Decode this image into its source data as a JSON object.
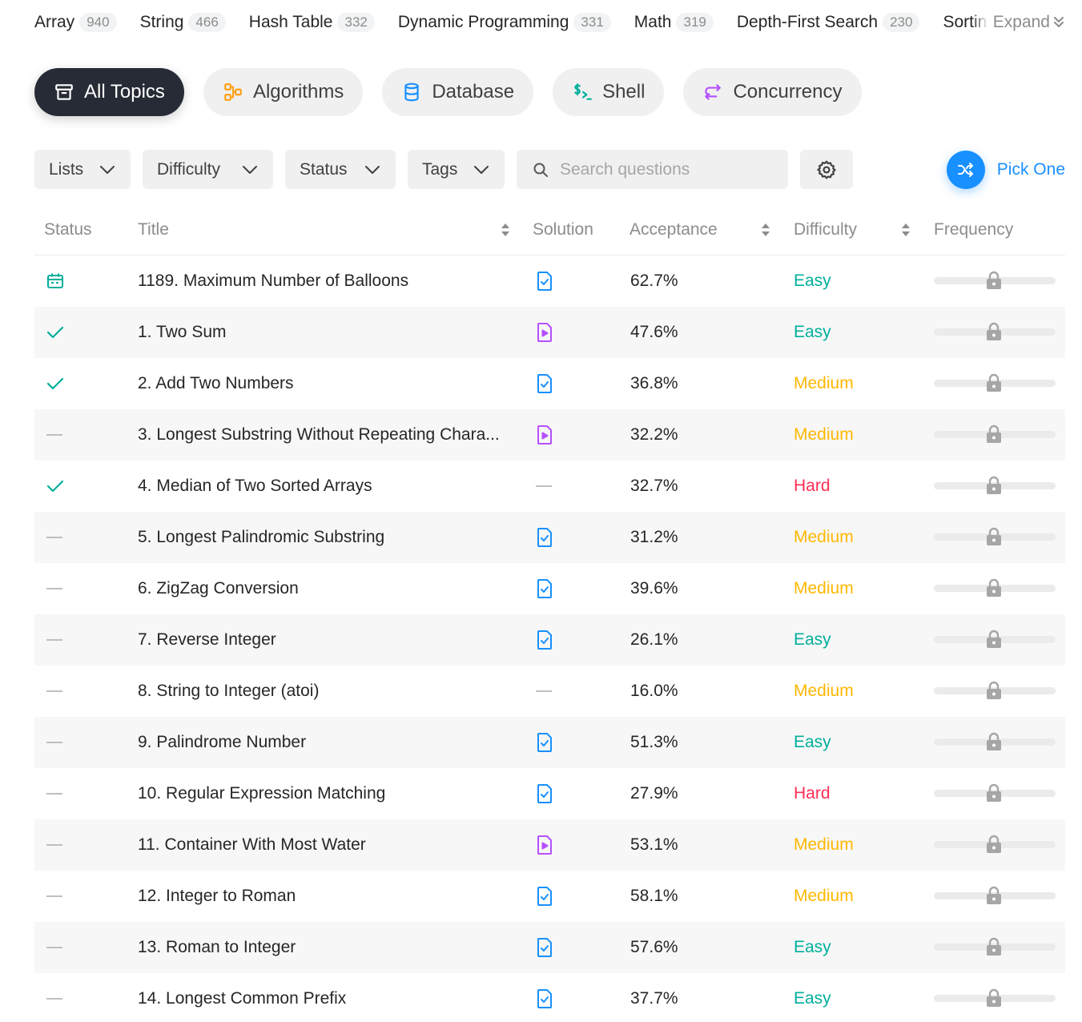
{
  "tags": [
    {
      "name": "Array",
      "count": "940"
    },
    {
      "name": "String",
      "count": "466"
    },
    {
      "name": "Hash Table",
      "count": "332"
    },
    {
      "name": "Dynamic Programming",
      "count": "331"
    },
    {
      "name": "Math",
      "count": "319"
    },
    {
      "name": "Depth-First Search",
      "count": "230"
    },
    {
      "name": "Sorting",
      "count": ""
    }
  ],
  "expand_label": "Expand",
  "categories": [
    {
      "label": "All Topics",
      "icon": "layers-icon",
      "active": true
    },
    {
      "label": "Algorithms",
      "icon": "flow-icon",
      "color": "#ffa116"
    },
    {
      "label": "Database",
      "icon": "database-icon",
      "color": "#1890ff"
    },
    {
      "label": "Shell",
      "icon": "terminal-icon",
      "color": "#00af9b"
    },
    {
      "label": "Concurrency",
      "icon": "concurrency-icon",
      "color": "#b650ff"
    }
  ],
  "filters": {
    "lists": "Lists",
    "difficulty": "Difficulty",
    "status": "Status",
    "tags": "Tags",
    "search_placeholder": "Search questions",
    "pick_one": "Pick One"
  },
  "columns": {
    "status": "Status",
    "title": "Title",
    "solution": "Solution",
    "acceptance": "Acceptance",
    "difficulty": "Difficulty",
    "frequency": "Frequency"
  },
  "colors": {
    "easy": "#00af9b",
    "medium": "#ffb800",
    "hard": "#ff2d55",
    "accent": "#1890ff"
  },
  "rows": [
    {
      "status": "daily",
      "title": "1189. Maximum Number of Balloons",
      "solution": "article",
      "acceptance": "62.7%",
      "difficulty": "Easy"
    },
    {
      "status": "solved",
      "title": "1. Two Sum",
      "solution": "video",
      "acceptance": "47.6%",
      "difficulty": "Easy"
    },
    {
      "status": "solved",
      "title": "2. Add Two Numbers",
      "solution": "article",
      "acceptance": "36.8%",
      "difficulty": "Medium"
    },
    {
      "status": "none",
      "title": "3. Longest Substring Without Repeating Chara...",
      "solution": "video",
      "acceptance": "32.2%",
      "difficulty": "Medium"
    },
    {
      "status": "solved",
      "title": "4. Median of Two Sorted Arrays",
      "solution": "none",
      "acceptance": "32.7%",
      "difficulty": "Hard"
    },
    {
      "status": "none",
      "title": "5. Longest Palindromic Substring",
      "solution": "article",
      "acceptance": "31.2%",
      "difficulty": "Medium"
    },
    {
      "status": "none",
      "title": "6. ZigZag Conversion",
      "solution": "article",
      "acceptance": "39.6%",
      "difficulty": "Medium"
    },
    {
      "status": "none",
      "title": "7. Reverse Integer",
      "solution": "article",
      "acceptance": "26.1%",
      "difficulty": "Easy"
    },
    {
      "status": "none",
      "title": "8. String to Integer (atoi)",
      "solution": "none",
      "acceptance": "16.0%",
      "difficulty": "Medium"
    },
    {
      "status": "none",
      "title": "9. Palindrome Number",
      "solution": "article",
      "acceptance": "51.3%",
      "difficulty": "Easy"
    },
    {
      "status": "none",
      "title": "10. Regular Expression Matching",
      "solution": "article",
      "acceptance": "27.9%",
      "difficulty": "Hard"
    },
    {
      "status": "none",
      "title": "11. Container With Most Water",
      "solution": "video",
      "acceptance": "53.1%",
      "difficulty": "Medium"
    },
    {
      "status": "none",
      "title": "12. Integer to Roman",
      "solution": "article",
      "acceptance": "58.1%",
      "difficulty": "Medium"
    },
    {
      "status": "none",
      "title": "13. Roman to Integer",
      "solution": "article",
      "acceptance": "57.6%",
      "difficulty": "Easy"
    },
    {
      "status": "none",
      "title": "14. Longest Common Prefix",
      "solution": "article",
      "acceptance": "37.7%",
      "difficulty": "Easy"
    }
  ]
}
